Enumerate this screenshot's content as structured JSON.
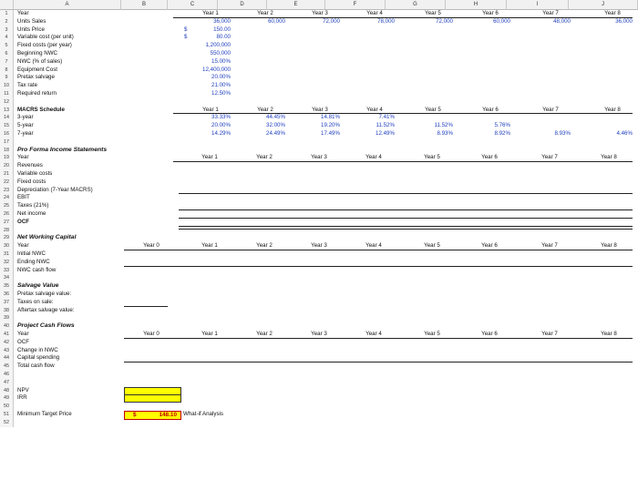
{
  "columns": [
    "A",
    "B",
    "C",
    "D",
    "E",
    "F",
    "G",
    "H",
    "I",
    "J"
  ],
  "rows": [
    "1",
    "2",
    "3",
    "4",
    "5",
    "6",
    "7",
    "8",
    "9",
    "10",
    "11",
    "12",
    "13",
    "14",
    "15",
    "16",
    "17",
    "18",
    "19",
    "20",
    "21",
    "22",
    "23",
    "24",
    "25",
    "26",
    "27",
    "28",
    "29",
    "30",
    "31",
    "32",
    "33",
    "34",
    "35",
    "36",
    "37",
    "38",
    "39",
    "40",
    "41",
    "42",
    "43",
    "44",
    "45",
    "46",
    "47",
    "48",
    "49",
    "50",
    "51",
    "52"
  ],
  "years": [
    "Year 1",
    "Year 2",
    "Year 3",
    "Year 4",
    "Year 5",
    "Year 6",
    "Year 7",
    "Year 8"
  ],
  "year0": "Year 0",
  "inputs": {
    "labels": [
      "Year",
      "Units Sales",
      "Units Price",
      "Variable cost (per unit)",
      "Fixed costs (per year)",
      "Beginning NWC",
      "NWC (% of sales)",
      "Equipment Cost",
      "Pretax salvage",
      "Tax rate",
      "Required return"
    ],
    "units_sales": [
      "36,000",
      "60,000",
      "72,000",
      "78,000",
      "72,000",
      "60,000",
      "48,000",
      "36,000"
    ],
    "dollar_sign": "$",
    "values": [
      "150.00",
      "80.00",
      "1,200,000",
      "550,000",
      "15.00%",
      "12,400,000",
      "20.00%",
      "21.00%",
      "12.50%"
    ]
  },
  "macrs": {
    "title": "MACRS Schedule",
    "labels": [
      "3-year",
      "5-year",
      "7-year"
    ],
    "three": [
      "33.33%",
      "44.45%",
      "14.81%",
      "7.41%"
    ],
    "five": [
      "20.00%",
      "32.00%",
      "19.20%",
      "11.52%",
      "11.52%",
      "5.76%"
    ],
    "seven": [
      "14.29%",
      "24.49%",
      "17.49%",
      "12.49%",
      "8.93%",
      "8.92%",
      "8.93%",
      "4.46%"
    ]
  },
  "income": {
    "title": "Pro Forma Income Statements",
    "labels": [
      "Year",
      "Revenues",
      "Variable costs",
      "Fixed costs",
      "Depreciation (7-Year MACRS)",
      "EBIT",
      "Taxes (21%)",
      "Net income",
      "OCF"
    ]
  },
  "nwc": {
    "title": "Net Working Capital",
    "labels": [
      "Year",
      "Initial NWC",
      "Ending NWC",
      "NWC cash flow"
    ]
  },
  "salvage": {
    "title": "Salvage Value",
    "labels": [
      "Pretax salvage value:",
      "Taxes on sale:",
      "Aftertax salvage value:"
    ]
  },
  "cashflows": {
    "title": "Project Cash Flows",
    "labels": [
      "Year",
      "OCF",
      "Change in NWC",
      "Capital spending",
      "Total cash flow"
    ]
  },
  "npv_label": "NPV",
  "irr_label": "IRR",
  "target": {
    "label": "Minimum Target Price",
    "currency": "$",
    "value": "148.10",
    "note": "What-if Analysis"
  }
}
